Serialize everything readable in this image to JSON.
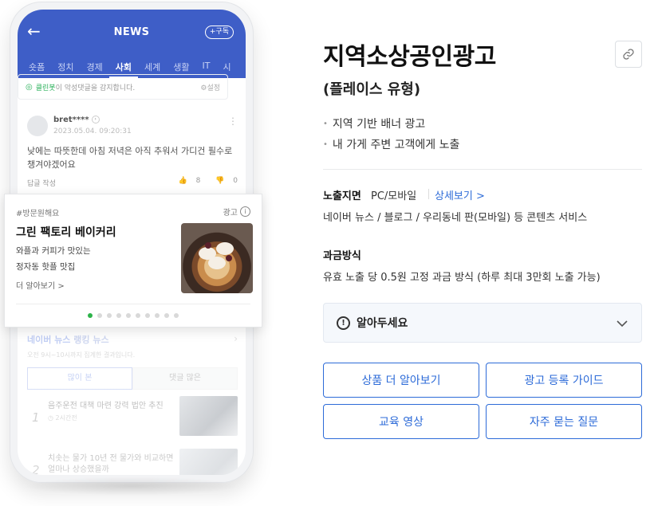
{
  "phone": {
    "topbar": {
      "back_icon": "←",
      "title": "NEWS",
      "subscribe": "+구독"
    },
    "categories": [
      "숏폼",
      "정치",
      "경제",
      "사회",
      "세계",
      "생활",
      "IT",
      "시"
    ],
    "active_category": "사회",
    "cleanbot": {
      "brand": "클린봇",
      "text": "이 악성댓글을 감지합니다.",
      "settings": "설정"
    },
    "comment": {
      "user": "bret****",
      "date": "2023.05.04. 09:20:31",
      "text": "낮에는 따뜻한데 아침 저녁은 아직 추워서 가디건 필수로 챙겨야겠어요",
      "reply": "답글 작성",
      "likes": "8",
      "dislikes": "0"
    },
    "ranking": {
      "brand": "네이버 뉴스",
      "title": " 랭킹 뉴스",
      "subtitle": "오전 9시~10시까지 집계한 결과입니다.",
      "tabs": [
        "많이 본",
        "댓글 많은"
      ],
      "items": [
        {
          "num": "1",
          "headline": "음주운전 대책 마련 강력 법안 추진",
          "time": "2시간전"
        },
        {
          "num": "2",
          "headline": "치솟는 물가 10년 전 물가와 비교하면 얼마나 상승했을까"
        }
      ]
    }
  },
  "ad": {
    "tag": "#방문원해요",
    "label": "광고",
    "title": "그린 팩토리 베이커리",
    "desc1": "와플과 커피가 맛있는",
    "desc2": "정자동 핫플 맛집",
    "more": "더 알아보기 >",
    "dots_total": 10,
    "dots_active": 0
  },
  "panel": {
    "title": "지역소상공인광고",
    "subtitle": "(플레이스 유형)",
    "bullets": [
      "지역 기반 배너 광고",
      "내 가게 주변 고객에게 노출"
    ],
    "exposure": {
      "label": "노출지면",
      "value": "PC/모바일",
      "link": "상세보기 >",
      "desc": "네이버 뉴스 / 블로그 / 우리동네 판(모바일) 등 콘텐츠 서비스"
    },
    "billing": {
      "label": "과금방식",
      "desc": "유효 노출 당 0.5원 고정 과금 방식 (하루 최대 3만회 노출 가능)"
    },
    "notice": "알아두세요",
    "buttons": [
      "상품 더 알아보기",
      "광고 등록 가이드",
      "교육 영상",
      "자주 묻는 질문"
    ]
  },
  "colors": {
    "naver_blue": "#3e5ec7",
    "link_blue": "#2d6bd8",
    "green": "#2db34a"
  },
  "icons": {
    "link": "link-icon",
    "notice": "alert-circle-icon",
    "chevron": "chevron-down-icon",
    "info": "info-icon"
  }
}
